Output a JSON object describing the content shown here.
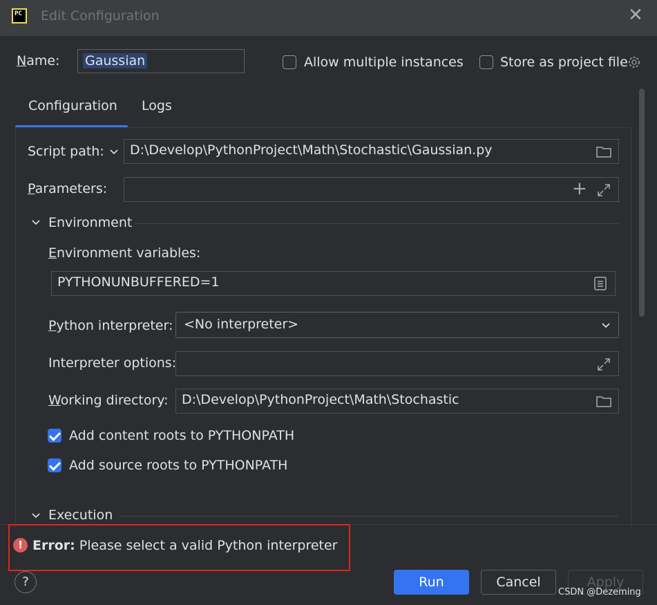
{
  "window": {
    "title": "Edit Configuration"
  },
  "name_row": {
    "name_label": "Name:",
    "name_value": "Gaussian",
    "allow_multiple_label": "Allow multiple instances",
    "allow_multiple_checked": false,
    "store_project_label": "Store as project file",
    "store_project_checked": false
  },
  "tabs": [
    {
      "label": "Configuration",
      "active": true
    },
    {
      "label": "Logs",
      "active": false
    }
  ],
  "script": {
    "label": "Script path:",
    "value": "D:\\Develop\\PythonProject\\Math\\Stochastic\\Gaussian.py"
  },
  "parameters": {
    "label": "Parameters:",
    "value": ""
  },
  "environment": {
    "section_label": "Environment",
    "env_vars_label": "Environment variables:",
    "env_vars_value": "PYTHONUNBUFFERED=1",
    "interpreter_label": "Python interpreter:",
    "interpreter_value": "<No interpreter>",
    "interp_options_label": "Interpreter options:",
    "interp_options_value": "",
    "workdir_label": "Working directory:",
    "workdir_value": "D:\\Develop\\PythonProject\\Math\\Stochastic",
    "content_roots_label": "Add content roots to PYTHONPATH",
    "content_roots_checked": true,
    "source_roots_label": "Add source roots to PYTHONPATH",
    "source_roots_checked": true
  },
  "execution": {
    "section_label": "Execution"
  },
  "error": {
    "prefix": "Error:",
    "message": "Please select a valid Python interpreter"
  },
  "footer": {
    "help_label": "?",
    "run_label": "Run",
    "cancel_label": "Cancel",
    "apply_label": "Apply",
    "watermark": "CSDN @Dezeming"
  },
  "colors": {
    "accent": "#3574f0",
    "error": "#db5c5c",
    "highlight_box": "#e0261e"
  }
}
